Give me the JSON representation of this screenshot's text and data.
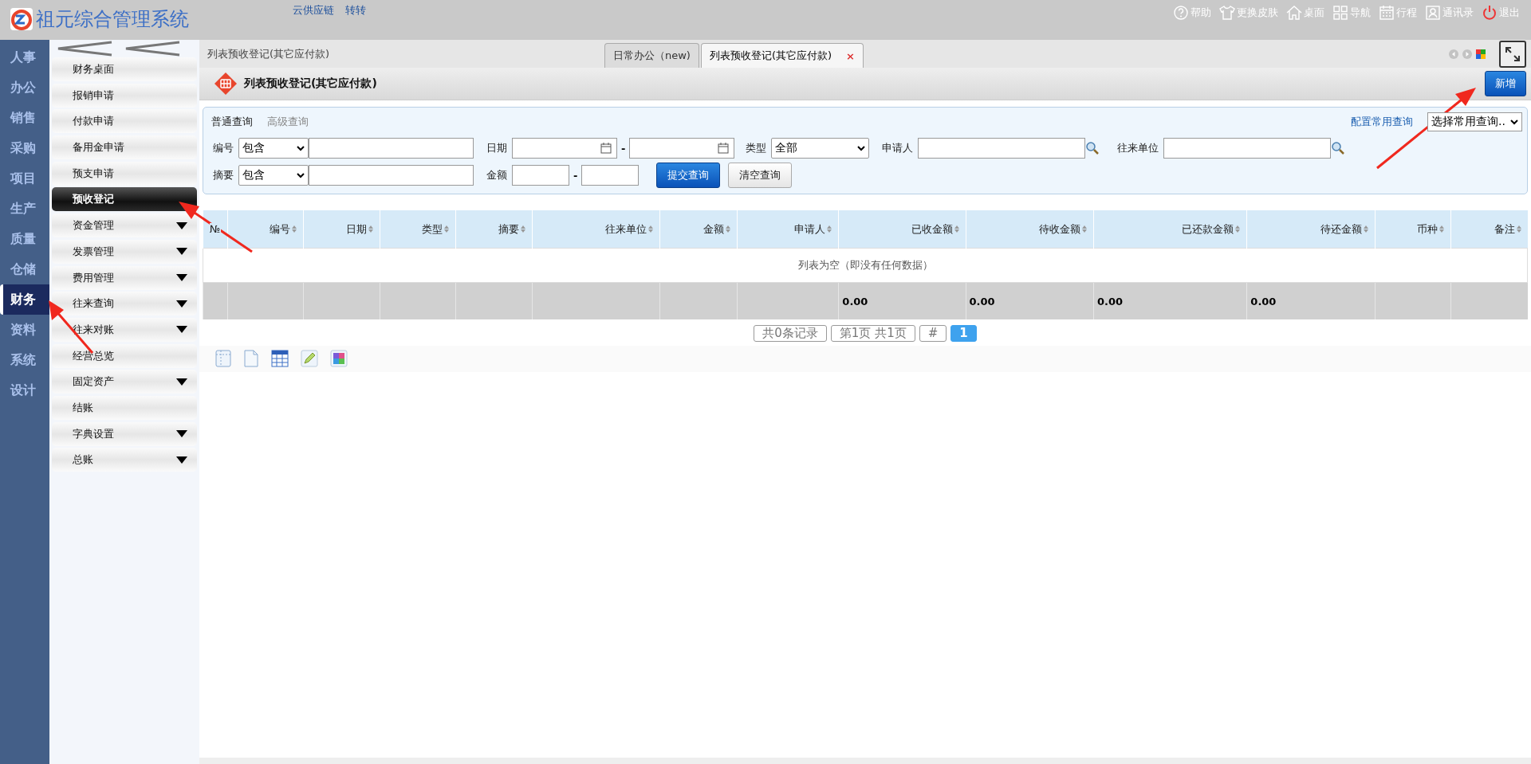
{
  "app": {
    "title": "祖元综合管理系统",
    "links": [
      "云供应链",
      "转转"
    ]
  },
  "top_actions": [
    {
      "label": "帮助"
    },
    {
      "label": "更换皮肤"
    },
    {
      "label": "桌面"
    },
    {
      "label": "导航"
    },
    {
      "label": "行程"
    },
    {
      "label": "通讯录"
    },
    {
      "label": "退出"
    }
  ],
  "nav": [
    {
      "label": "人事",
      "selected": false
    },
    {
      "label": "办公",
      "selected": false
    },
    {
      "label": "销售",
      "selected": false
    },
    {
      "label": "采购",
      "selected": false
    },
    {
      "label": "项目",
      "selected": false
    },
    {
      "label": "生产",
      "selected": false
    },
    {
      "label": "质量",
      "selected": false
    },
    {
      "label": "仓储",
      "selected": false
    },
    {
      "label": "财务",
      "selected": true
    },
    {
      "label": "资料",
      "selected": false
    },
    {
      "label": "系统",
      "selected": false
    },
    {
      "label": "设计",
      "selected": false
    }
  ],
  "submenu": [
    {
      "label": "财务桌面",
      "selected": false,
      "expandable": false
    },
    {
      "label": "报销申请",
      "selected": false,
      "expandable": false
    },
    {
      "label": "付款申请",
      "selected": false,
      "expandable": false
    },
    {
      "label": "备用金申请",
      "selected": false,
      "expandable": false
    },
    {
      "label": "预支申请",
      "selected": false,
      "expandable": false
    },
    {
      "label": "预收登记",
      "selected": true,
      "expandable": false
    },
    {
      "label": "资金管理",
      "selected": false,
      "expandable": true
    },
    {
      "label": "发票管理",
      "selected": false,
      "expandable": true
    },
    {
      "label": "费用管理",
      "selected": false,
      "expandable": true
    },
    {
      "label": "往来查询",
      "selected": false,
      "expandable": true
    },
    {
      "label": "往来对账",
      "selected": false,
      "expandable": true
    },
    {
      "label": "经营总览",
      "selected": false,
      "expandable": false
    },
    {
      "label": "固定资产",
      "selected": false,
      "expandable": true
    },
    {
      "label": "结账",
      "selected": false,
      "expandable": false
    },
    {
      "label": "字典设置",
      "selected": false,
      "expandable": true
    },
    {
      "label": "总账",
      "selected": false,
      "expandable": true
    }
  ],
  "breadcrumb": "列表预收登记(其它应付款)",
  "tabs": [
    {
      "label": "日常办公（new)",
      "selected": false
    },
    {
      "label": "列表预收登记(其它应付款)",
      "selected": true,
      "close": "×"
    }
  ],
  "page_header": {
    "title": "列表预收登记(其它应付款)",
    "add_button": "新增"
  },
  "query": {
    "tabs": [
      {
        "label": "普通查询",
        "selected": true
      },
      {
        "label": "高级查询",
        "selected": false
      }
    ],
    "config_link": "配置常用查询",
    "common_select": "选择常用查询..",
    "first_line": [
      {
        "kind": "match",
        "label": "编号",
        "value": "包含"
      },
      {
        "kind": "daterange",
        "label": "日期",
        "separator": "-"
      },
      {
        "kind": "select",
        "label": "类型",
        "value": "全部"
      },
      {
        "kind": "lookup",
        "label": "申请人"
      },
      {
        "kind": "lookup",
        "label": "往来单位"
      }
    ],
    "second_line": [
      {
        "kind": "match",
        "label": "摘要",
        "value": "包含"
      },
      {
        "kind": "range",
        "label": "金额",
        "separator": "-"
      },
      {
        "kind": "button",
        "label": "提交查询",
        "primary": true
      },
      {
        "kind": "button",
        "label": "清空查询",
        "primary": false
      }
    ]
  },
  "table": {
    "columns": [
      {
        "label": "№",
        "sortable": false
      },
      {
        "label": "编号",
        "sortable": true
      },
      {
        "label": "日期",
        "sortable": true
      },
      {
        "label": "类型",
        "sortable": true
      },
      {
        "label": "摘要",
        "sortable": true
      },
      {
        "label": "往来单位",
        "sortable": true
      },
      {
        "label": "金额",
        "sortable": true
      },
      {
        "label": "申请人",
        "sortable": true
      },
      {
        "label": "已收金额",
        "sortable": true,
        "total": "0.00"
      },
      {
        "label": "待收金额",
        "sortable": true,
        "total": "0.00"
      },
      {
        "label": "已还款金额",
        "sortable": true,
        "total": "0.00"
      },
      {
        "label": "待还金额",
        "sortable": true,
        "total": "0.00"
      },
      {
        "label": "币种",
        "sortable": true
      },
      {
        "label": "备注",
        "sortable": true
      }
    ],
    "empty_message": "列表为空（即没有任何数据）"
  },
  "pagination": {
    "items": [
      "共0条记录",
      "第1页 共1页",
      "#"
    ],
    "pages": [
      {
        "label": "1",
        "selected": true
      }
    ]
  }
}
